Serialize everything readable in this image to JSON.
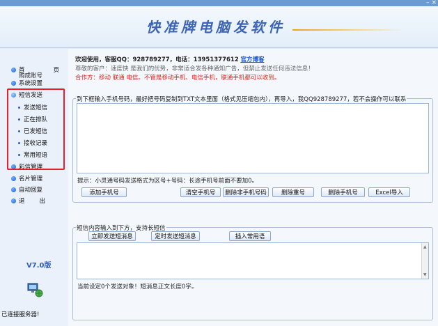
{
  "window": {
    "minimize": "–",
    "close": "×"
  },
  "header": {
    "title": "快准牌电脑发软件"
  },
  "sidebar": {
    "home_a": "首",
    "home_b": "页",
    "login": "购成账号",
    "settings": "系统设置",
    "sms_send": "短信发送",
    "sub_items": [
      "发送短信",
      "正在排队",
      "已发短信",
      "接收记录",
      "常用短语"
    ],
    "mms": "彩信管理",
    "cards": "名片管理",
    "auto_reply": "自动回复",
    "exit_a": "退",
    "exit_b": "出",
    "version": "V7.0版",
    "status": "已连接服务器!"
  },
  "notice": {
    "line1_prefix": "欢迎使用，客服QQ：928789277，电话：13951377612",
    "line1_link": "官方博客",
    "line2": "尊敬的客户：速度快 是我们的优势，非常适合发各种通知广告，但禁止发送任何违法信息！",
    "line3_prefix": "合作方：移动 联通 电信。",
    "line3_rest": "不管是移动手机、电信手机，联通手机都可以收到。"
  },
  "numbers_group": {
    "title": "到下框输入手机号码，最好把号码复制到TXT文本里面（格式见压缩包内），再导入，我QQ928789277，若不会操作可以联系",
    "hint": "提示：小灵通号码发送格式为区号+号码：长途手机号前面不要加0。",
    "buttons": {
      "add": "添加手机号",
      "clear": "清空手机号",
      "delete_non": "删除非手机号码",
      "delete_dup": "删除重号",
      "delete": "删除手机号",
      "excel": "Excel导入"
    }
  },
  "message_group": {
    "title": "短信内容输入到下方，支持长短信",
    "buttons": {
      "send_now": "立即发送短消息",
      "schedule": "定时发送短消息",
      "insert": "插入常用语"
    },
    "status": "当前设定0个发送对象！短消息正文长度0字。"
  },
  "colors": {
    "accent": "#3d63b4",
    "alert_red": "#e1251b",
    "highlight_box": "#e5202a"
  }
}
